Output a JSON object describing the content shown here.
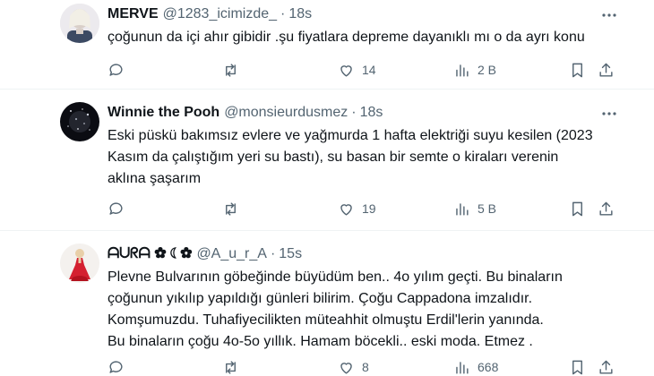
{
  "tweets": [
    {
      "name": "MERVE",
      "handle": "@1283_icimizde_",
      "dot": "·",
      "time": "18s",
      "lines": [
        "çoğunun da içi ahır gibidir .şu fiyatlara depreme dayanıklı mı o da ayrı konu"
      ],
      "replies": "",
      "retweets": "",
      "likes": "14",
      "views": "2 B"
    },
    {
      "name": "Winnie the Pooh",
      "handle": "@monsieurdusmez",
      "dot": "·",
      "time": "18s",
      "lines": [
        "Eski püskü bakımsız evlere ve yağmurda 1 hafta elektriği suyu kesilen (2023",
        "Kasım da çalıştığım yeri su bastı), su basan bir semte o kiraları verenin",
        "aklına şaşarım"
      ],
      "replies": "",
      "retweets": "",
      "likes": "19",
      "views": "5 B"
    },
    {
      "name": "ᗩᑌᖇᗩ ✿ ☾✿",
      "handle": "@A_u_r_A",
      "dot": "·",
      "time": "15s",
      "lines": [
        "Plevne Bulvarının göbeğinde büyüdüm ben.. 4o yılım geçti. Bu binaların",
        "çoğunun yıkılıp yapıldığı günleri bilirim. Çoğu Cappadona imzalıdır.",
        "Komşumuzdu. Tuhafiyecilikten müteahhit olmuştu Erdil'lerin yanında.",
        "Bu binaların çoğu 4o-5o yıllık. Hamam böcekli.. eski moda. Etmez ."
      ],
      "replies": "",
      "retweets": "",
      "likes": "8",
      "views": "668"
    }
  ]
}
